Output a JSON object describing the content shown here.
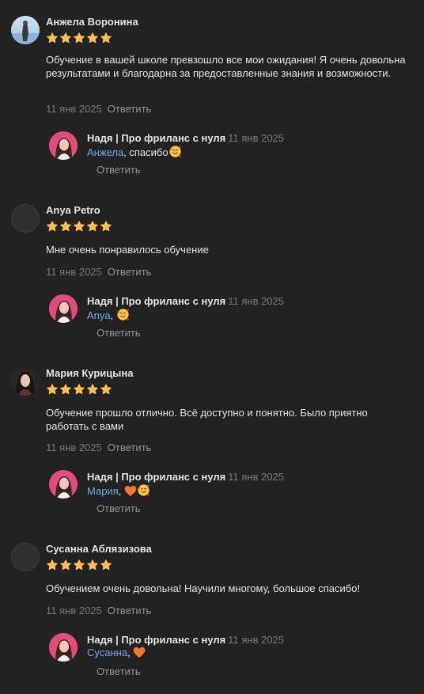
{
  "reviews": [
    {
      "author": "Анжела Воронина",
      "rating": 5,
      "text": "Обучение в вашей школе превзошло все мои ожидания! Я очень довольна результатами и благодарна за предоставленные знания и возможности.",
      "date": "11 янв 2025",
      "reply_label": "Ответить",
      "answer": {
        "author": "Надя | Про фриланс с нуля",
        "date": "11 янв 2025",
        "mention": "Анжела",
        "text": ", спасибо",
        "emojis": [
          "smiling-face-with-hearts-icon"
        ],
        "reply_label": "Ответить"
      }
    },
    {
      "author": "Anya Petro",
      "rating": 5,
      "text": "Мне очень понравилось обучение",
      "date": "11 янв 2025",
      "reply_label": "Ответить",
      "answer": {
        "author": "Надя | Про фриланс с нуля",
        "date": "11 янв 2025",
        "mention": "Anya",
        "text": ", ",
        "emojis": [
          "smiling-face-with-hearts-icon"
        ],
        "reply_label": "Ответить"
      }
    },
    {
      "author": "Мария Курицына",
      "rating": 5,
      "text": "Обучение прошло отлично. Всё доступно и понятно. Было приятно работать с вами",
      "date": "11 янв 2025",
      "reply_label": "Ответить",
      "answer": {
        "author": "Надя | Про фриланс с нуля",
        "date": "11 янв 2025",
        "mention": "Мария",
        "text": ", ",
        "emojis": [
          "orange-heart-icon",
          "smiling-face-with-hearts-icon"
        ],
        "reply_label": "Ответить"
      }
    },
    {
      "author": "Сусанна Аблязизова",
      "rating": 5,
      "text": "Обучением очень довольна! Научили многому, большое спасибо!",
      "date": "11 янв 2025",
      "reply_label": "Ответить",
      "answer": {
        "author": "Надя | Про фриланс с нуля",
        "date": "11 янв 2025",
        "mention": "Сусанна",
        "text": ", ",
        "emojis": [
          "orange-heart-icon"
        ],
        "reply_label": "Ответить"
      }
    }
  ],
  "colors": {
    "background": "#222222",
    "text": "#e1e3e6",
    "muted": "#76787a",
    "link": "#71aaeb",
    "star": "#ffc051"
  }
}
